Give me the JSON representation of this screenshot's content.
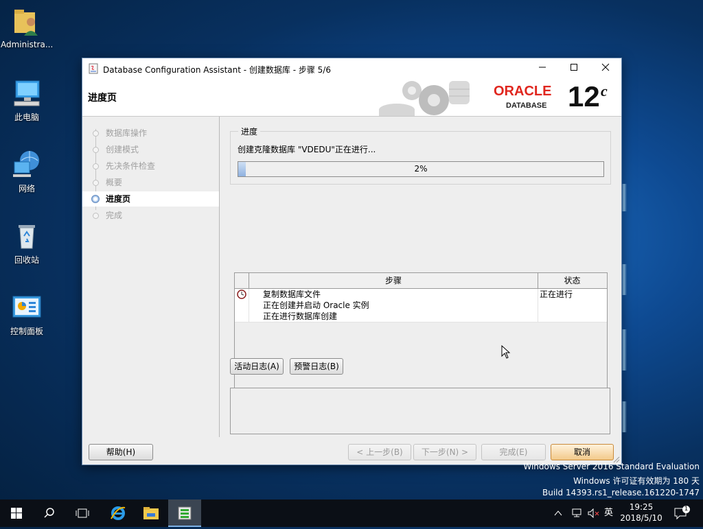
{
  "desktop": {
    "icons": [
      {
        "label": "Administra...",
        "icon": "user-folder-icon"
      },
      {
        "label": "此电脑",
        "icon": "computer-icon"
      },
      {
        "label": "网络",
        "icon": "network-icon"
      },
      {
        "label": "回收站",
        "icon": "recycle-bin-icon"
      },
      {
        "label": "控制面板",
        "icon": "control-panel-icon"
      }
    ],
    "watermark": {
      "line1": "Windows Server 2016 Standard Evaluation",
      "line2": "Windows 许可证有效期为 180 天",
      "line3": "Build 14393.rs1_release.161220-1747"
    }
  },
  "window": {
    "title": "Database Configuration Assistant - 创建数据库 - 步骤 5/6",
    "minimize": "—",
    "maximize": "☐",
    "close": "✕",
    "page_title": "进度页",
    "logo": {
      "brand": "ORACLE",
      "product": "DATABASE",
      "version": "12",
      "version_sup": "c"
    }
  },
  "nav": {
    "items": [
      {
        "label": "数据库操作",
        "state": "done"
      },
      {
        "label": "创建模式",
        "state": "done"
      },
      {
        "label": "先决条件检查",
        "state": "done"
      },
      {
        "label": "概要",
        "state": "done"
      },
      {
        "label": "进度页",
        "state": "active"
      },
      {
        "label": "完成",
        "state": "pending"
      }
    ]
  },
  "progress": {
    "legend": "进度",
    "status_text": "创建克隆数据库 \"VDEDU\"正在进行...",
    "percent": 2,
    "percent_label": "2%"
  },
  "steps_table": {
    "columns": [
      "步骤",
      "状态"
    ],
    "rows": [
      {
        "step": "复制数据库文件",
        "status": "正在进行",
        "icon": "clock-icon"
      },
      {
        "step": "正在创建并启动 Oracle 实例",
        "status": "",
        "icon": ""
      },
      {
        "step": "正在进行数据库创建",
        "status": "",
        "icon": ""
      }
    ]
  },
  "buttons": {
    "activity_log": "活动日志(A)",
    "alert_log": "预警日志(B)",
    "help": "帮助(H)",
    "back": "< 上一步(B)",
    "next": "下一步(N) >",
    "finish": "完成(E)",
    "cancel": "取消"
  },
  "taskbar": {
    "ime": "英",
    "time": "19:25",
    "date": "2018/5/10",
    "notification_count": "1"
  },
  "colors": {
    "accent_red": "#e0261e",
    "progress_fill": "#8fb1df"
  }
}
